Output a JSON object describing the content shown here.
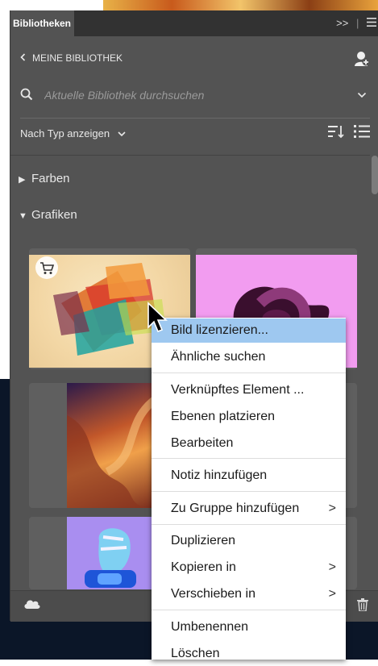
{
  "panel": {
    "tab_label": "Bibliotheken",
    "expand_glyph": ">>",
    "library_title": "MEINE BIBLIOTHEK",
    "search_placeholder": "Aktuelle Bibliothek durchsuchen",
    "view_by_label": "Nach Typ anzeigen",
    "sections": [
      {
        "label": "Farben",
        "expanded": false
      },
      {
        "label": "Grafiken",
        "expanded": true
      }
    ]
  },
  "icons": {
    "back": "chevron-left-icon",
    "user": "user-add-icon",
    "search": "search-icon",
    "dropdown": "chevron-down-icon",
    "sort": "sort-icon",
    "list": "list-view-icon",
    "cart": "cart-icon",
    "cloud": "cloud-icon",
    "trash": "trash-icon"
  },
  "context_menu": {
    "items": [
      {
        "label": "Bild lizenzieren...",
        "highlighted": true,
        "submenu": false
      },
      {
        "label": "Ähnliche suchen",
        "highlighted": false,
        "submenu": false
      },
      {
        "label": "Verknüpftes Element ...",
        "highlighted": false,
        "submenu": false
      },
      {
        "label": "Ebenen platzieren",
        "highlighted": false,
        "submenu": false
      },
      {
        "label": "Bearbeiten",
        "highlighted": false,
        "submenu": false
      },
      {
        "label": "Notiz hinzufügen",
        "highlighted": false,
        "submenu": false
      },
      {
        "label": "Zu Gruppe hinzufügen",
        "highlighted": false,
        "submenu": true
      },
      {
        "label": "Duplizieren",
        "highlighted": false,
        "submenu": false
      },
      {
        "label": "Kopieren in",
        "highlighted": false,
        "submenu": true
      },
      {
        "label": "Verschieben in",
        "highlighted": false,
        "submenu": true
      },
      {
        "label": "Umbenennen",
        "highlighted": false,
        "submenu": false
      },
      {
        "label": "Löschen",
        "highlighted": false,
        "submenu": false
      }
    ],
    "submenu_glyph": ">"
  },
  "colors": {
    "panel_bg": "#535353",
    "menu_highlight": "#9ec8f0"
  }
}
